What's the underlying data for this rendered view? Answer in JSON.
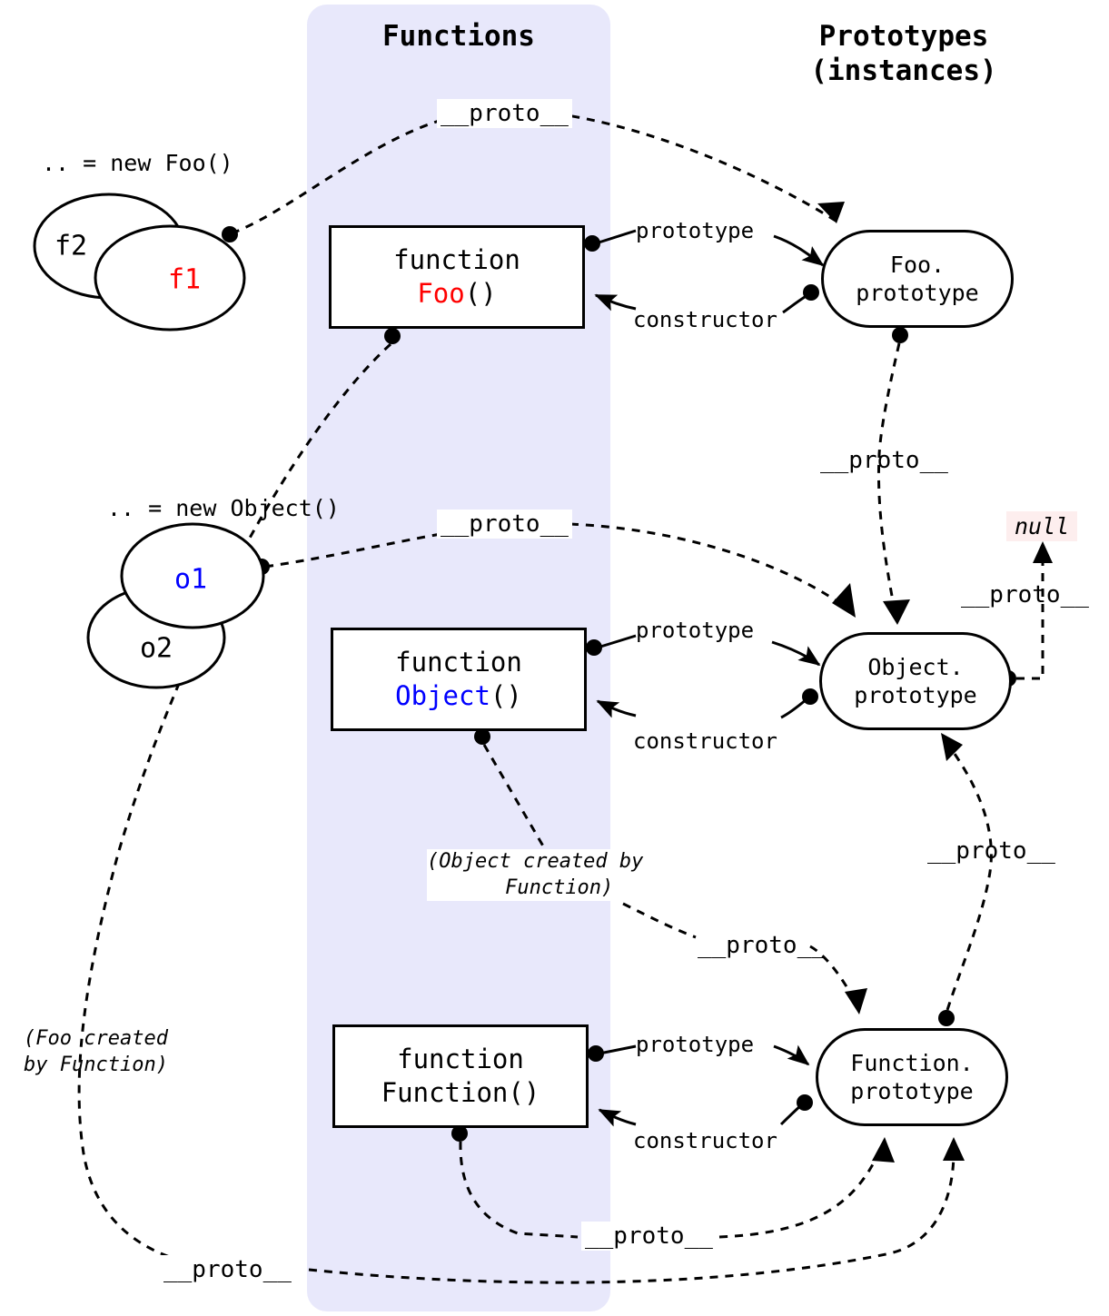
{
  "headers": {
    "functions": "Functions",
    "prototypes_line1": "Prototypes",
    "prototypes_line2": "(instances)"
  },
  "instances": {
    "foo_caption": ".. = new Foo()",
    "foo_back_circle": "f2",
    "foo_front_circle": "f1",
    "object_caption": ".. = new Object()",
    "object_front_circle": "o1",
    "object_back_circle": "o2"
  },
  "function_boxes": [
    {
      "keyword": "function",
      "name": "Foo",
      "parens": "()",
      "name_color": "#ff0000"
    },
    {
      "keyword": "function",
      "name": "Object",
      "parens": "()",
      "name_color": "#0000ff"
    },
    {
      "keyword": "function",
      "name": "Function",
      "parens": "()",
      "name_color": "#000000"
    }
  ],
  "prototype_nodes": [
    {
      "line1": "Foo.",
      "line2": "prototype"
    },
    {
      "line1": "Object.",
      "line2": "prototype"
    },
    {
      "line1": "Function.",
      "line2": "prototype"
    }
  ],
  "edge_labels": {
    "proto": "__proto__",
    "prototype": "prototype",
    "constructor": "constructor"
  },
  "notes": {
    "object_created": "(Object created by\n    Function)",
    "foo_created": "(Foo created\nby Function)"
  },
  "null_value": "null",
  "colors": {
    "band": "#e8e8fb",
    "null_bg": "#fdeeee",
    "null_text": "#000000",
    "foo_accent": "#ff0000",
    "object_accent": "#0000ff",
    "stroke": "#000000"
  }
}
